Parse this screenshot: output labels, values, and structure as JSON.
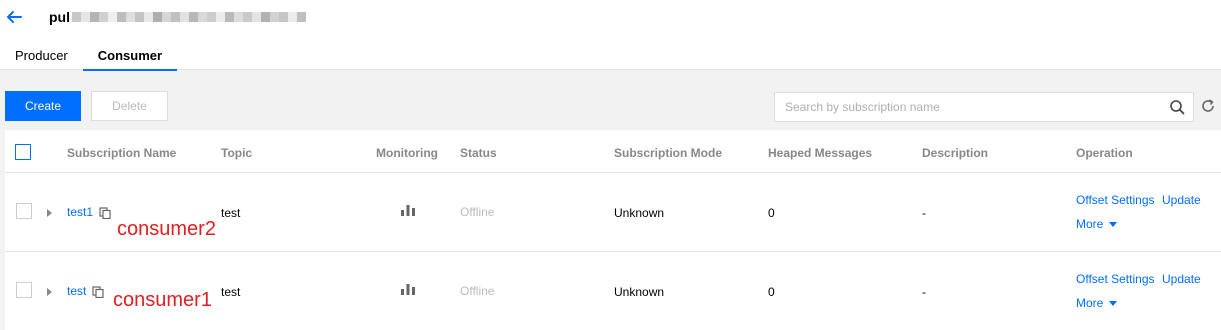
{
  "header": {
    "title_visible": "pul",
    "title_mask_colors": [
      "#c8c8c8",
      "#e6e6e6",
      "#b4b4b4",
      "#d0d0d0",
      "#efefef",
      "#bdbdbd",
      "#dedede",
      "#c4c4c4",
      "#e9e9e9",
      "#aeaeae",
      "#d6d6d6",
      "#c0c0c0",
      "#e2e2e2",
      "#b8b8b8",
      "#d9d9d9",
      "#cdcdcd",
      "#ececec",
      "#bababa",
      "#dcdcdc",
      "#c9c9c9",
      "#e4e4e4",
      "#b2b2b2",
      "#d3d3d3",
      "#c6c6c6",
      "#ebebeb",
      "#bfbfbf"
    ],
    "back_icon": "arrow-left-icon"
  },
  "tabs": [
    {
      "label": "Producer",
      "active": false
    },
    {
      "label": "Consumer",
      "active": true
    }
  ],
  "toolbar": {
    "create_label": "Create",
    "delete_label": "Delete",
    "search_placeholder": "Search by subscription name",
    "search_value": "",
    "refresh_icon": "refresh-icon"
  },
  "table": {
    "columns": [
      "Subscription Name",
      "Topic",
      "Monitoring",
      "Status",
      "Subscription Mode",
      "Heaped Messages",
      "Description",
      "Operation"
    ],
    "rows": [
      {
        "name": "test1",
        "topic": "test",
        "status": "Offline",
        "mode": "Unknown",
        "heaped": "0",
        "description": "-",
        "op_offset": "Offset Settings",
        "op_update": "Update",
        "op_more": "More",
        "annotation": "consumer2"
      },
      {
        "name": "test",
        "topic": "test",
        "status": "Offline",
        "mode": "Unknown",
        "heaped": "0",
        "description": "-",
        "op_offset": "Offset Settings",
        "op_update": "Update",
        "op_more": "More",
        "annotation": "consumer1"
      }
    ]
  },
  "colors": {
    "primary": "#006eff",
    "annotation": "#e02020",
    "offline": "#bbbbbb"
  }
}
